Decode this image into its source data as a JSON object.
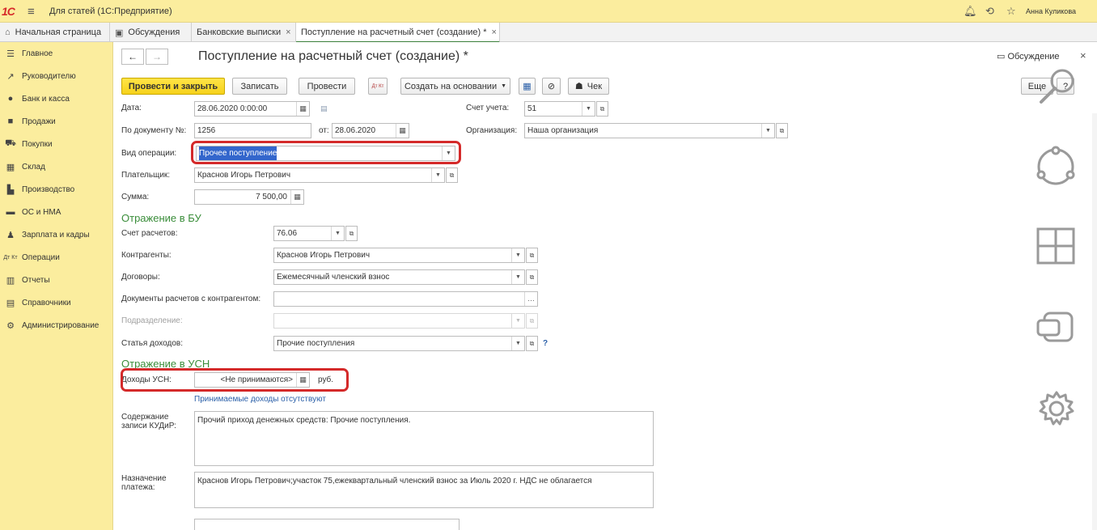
{
  "topbar": {
    "logo": "1С",
    "app_title": "Для статей   (1С:Предприятие)",
    "user": "Анна Куликова"
  },
  "tabs": [
    {
      "label": "Начальная страница",
      "icon": "home-icon"
    },
    {
      "label": "Обсуждения",
      "icon": "chat-icon"
    },
    {
      "label": "Банковские выписки",
      "icon": ""
    },
    {
      "label": "Поступление на расчетный счет (создание) *",
      "icon": ""
    }
  ],
  "sidebar": {
    "items": [
      {
        "label": "Главное",
        "icon": "menu-icon"
      },
      {
        "label": "Руководителю",
        "icon": "chart-icon"
      },
      {
        "label": "Банк и касса",
        "icon": "bank-icon"
      },
      {
        "label": "Продажи",
        "icon": "bag-icon"
      },
      {
        "label": "Покупки",
        "icon": "cart-icon"
      },
      {
        "label": "Склад",
        "icon": "warehouse-icon"
      },
      {
        "label": "Производство",
        "icon": "factory-icon"
      },
      {
        "label": "ОС и НМА",
        "icon": "truck-icon"
      },
      {
        "label": "Зарплата и кадры",
        "icon": "person-icon"
      },
      {
        "label": "Операции",
        "icon": "dt-kt-icon"
      },
      {
        "label": "Отчеты",
        "icon": "report-icon"
      },
      {
        "label": "Справочники",
        "icon": "book-icon"
      },
      {
        "label": "Администрирование",
        "icon": "gear-icon"
      }
    ]
  },
  "document": {
    "title": "Поступление на расчетный счет (создание) *",
    "discuss": "Обсуждение",
    "toolbar": {
      "post_close": "Провести и закрыть",
      "save": "Записать",
      "post": "Провести",
      "dtkt": "Дт Кт",
      "create_based": "Создать на основании",
      "check": "Чек",
      "more": "Еще",
      "help": "?"
    },
    "fields": {
      "date_label": "Дата:",
      "date_value": "28.06.2020  0:00:00",
      "account_label": "Счет учета:",
      "account_value": "51",
      "doc_num_label": "По документу №:",
      "doc_num_value": "1256",
      "from_label": "от:",
      "from_value": "28.06.2020",
      "org_label": "Организация:",
      "org_value": "Наша организация",
      "op_type_label": "Вид операции:",
      "op_type_value": "Прочее поступление",
      "payer_label": "Плательщик:",
      "payer_value": "Краснов Игорь Петрович",
      "sum_label": "Сумма:",
      "sum_value": "7 500,00"
    },
    "bu_section": {
      "title": "Отражение в БУ",
      "settle_acc_label": "Счет расчетов:",
      "settle_acc_value": "76.06",
      "contractors_label": "Контрагенты:",
      "contractors_value": "Краснов Игорь Петрович",
      "contracts_label": "Договоры:",
      "contracts_value": "Ежемесячный членский взнос",
      "settle_docs_label": "Документы расчетов с контрагентом:",
      "settle_docs_value": "",
      "division_label": "Подразделение:",
      "division_value": "",
      "income_item_label": "Статья доходов:",
      "income_item_value": "Прочие поступления",
      "help": "?"
    },
    "usn_section": {
      "title": "Отражение в УСН",
      "income_label": "Доходы УСН:",
      "income_value": "<Не принимаются>",
      "currency": "руб.",
      "accepted_link": "Принимаемые доходы отсутствуют",
      "kudir_label_1": "Содержание",
      "kudir_label_2": "записи КУДиР:",
      "kudir_value": "Прочий приход денежных средств: Прочие поступления.",
      "purpose_label_1": "Назначение",
      "purpose_label_2": "платежа:",
      "purpose_value": "Краснов Игорь Петрович;участок 75,ежеквартальный членский взнос за Июль 2020 г. НДС не облагается"
    }
  },
  "colors": {
    "sidebar_bg": "#fbed9e",
    "section_green": "#3a8d3a",
    "highlight_red": "#d42a2a",
    "primary_button": "#f6d21b"
  }
}
